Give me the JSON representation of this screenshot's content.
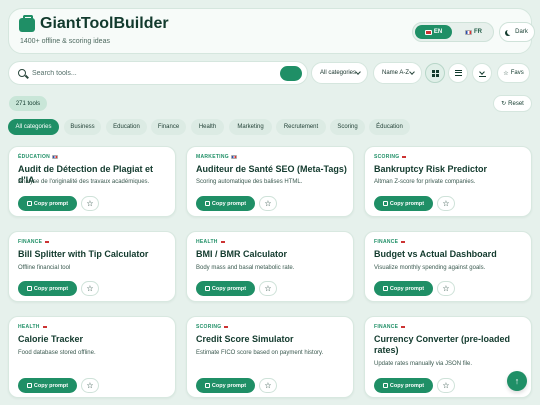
{
  "header": {
    "title": "GiantToolBuilder",
    "subtitle": "1400+ offline & scoring ideas",
    "lang_en": "EN",
    "lang_fr": "FR",
    "dark_label": "Dark"
  },
  "toolbar": {
    "search_placeholder": "Search tools...",
    "category_select": "All categories",
    "sort_select": "Name A-Z",
    "favs_label": "Favs"
  },
  "summary": {
    "count_label": "271 tools",
    "reset_label": "Reset"
  },
  "chips": [
    {
      "label": "All categories",
      "active": true
    },
    {
      "label": "Business"
    },
    {
      "label": "Education"
    },
    {
      "label": "Finance"
    },
    {
      "label": "Health"
    },
    {
      "label": "Marketing"
    },
    {
      "label": "Recrutement"
    },
    {
      "label": "Scoring"
    },
    {
      "label": "Éducation"
    }
  ],
  "cards": [
    {
      "tag": "ÉDUCATION",
      "flag": "fr",
      "title": "Audit de Détection de Plagiat et d'IA",
      "desc": "Analyse de l'originalité des travaux académiques.",
      "copy": "Copy prompt"
    },
    {
      "tag": "MARKETING",
      "flag": "fr",
      "title": "Auditeur de Santé SEO (Meta-Tags)",
      "desc": "Scoring automatique des balises HTML.",
      "copy": "Copy prompt"
    },
    {
      "tag": "SCORING",
      "flag": "en",
      "title": "Bankruptcy Risk Predictor",
      "desc": "Altman Z-score for private companies.",
      "copy": "Copy prompt"
    },
    {
      "tag": "FINANCE",
      "flag": "en",
      "title": "Bill Splitter with Tip Calculator",
      "desc": "Offline financial tool",
      "copy": "Copy prompt"
    },
    {
      "tag": "HEALTH",
      "flag": "en",
      "title": "BMI / BMR Calculator",
      "desc": "Body mass and basal metabolic rate.",
      "copy": "Copy prompt"
    },
    {
      "tag": "FINANCE",
      "flag": "en",
      "title": "Budget vs Actual Dashboard",
      "desc": "Visualize monthly spending against goals.",
      "copy": "Copy prompt"
    },
    {
      "tag": "HEALTH",
      "flag": "en",
      "title": "Calorie Tracker",
      "desc": "Food database stored offline.",
      "copy": "Copy prompt"
    },
    {
      "tag": "SCORING",
      "flag": "en",
      "title": "Credit Score Simulator",
      "desc": "Estimate FICO score based on payment history.",
      "copy": "Copy prompt"
    },
    {
      "tag": "FINANCE",
      "flag": "en",
      "title": "Currency Converter (pre-loaded rates)",
      "desc": "Update rates manually via JSON file.",
      "copy": "Copy prompt"
    }
  ],
  "colors": {
    "accent": "#1f8f66",
    "background": "#e6f1ec"
  }
}
